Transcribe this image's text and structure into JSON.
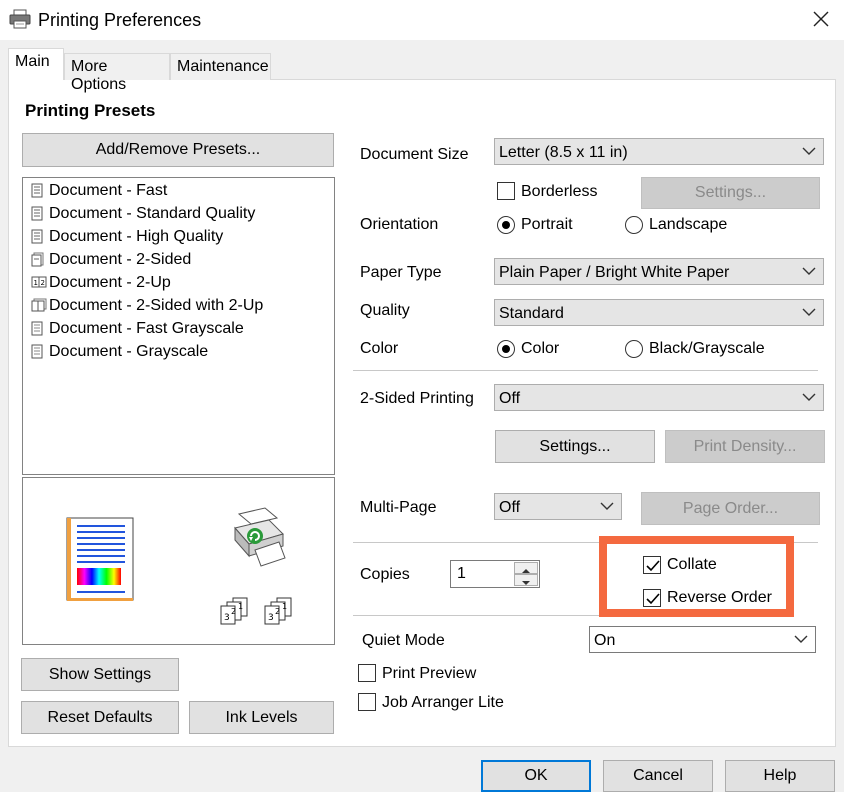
{
  "window": {
    "title": "Printing Preferences"
  },
  "tabs": [
    {
      "label": "Main"
    },
    {
      "label": "More Options"
    },
    {
      "label": "Maintenance"
    }
  ],
  "presets": {
    "heading": "Printing Presets",
    "add_remove_label": "Add/Remove Presets...",
    "items": [
      {
        "label": "Document - Fast"
      },
      {
        "label": "Document - Standard Quality"
      },
      {
        "label": "Document - High Quality"
      },
      {
        "label": "Document - 2-Sided"
      },
      {
        "label": "Document - 2-Up"
      },
      {
        "label": "Document - 2-Sided with 2-Up"
      },
      {
        "label": "Document - Fast Grayscale"
      },
      {
        "label": "Document - Grayscale"
      }
    ]
  },
  "settings": {
    "document_size_label": "Document Size",
    "document_size_value": "Letter (8.5 x 11 in)",
    "borderless_label": "Borderless",
    "borderless_settings_label": "Settings...",
    "orientation_label": "Orientation",
    "portrait_label": "Portrait",
    "landscape_label": "Landscape",
    "paper_type_label": "Paper Type",
    "paper_type_value": "Plain Paper / Bright White Paper",
    "quality_label": "Quality",
    "quality_value": "Standard",
    "color_label": "Color",
    "color_option_label": "Color",
    "bw_option_label": "Black/Grayscale",
    "two_sided_label": "2-Sided Printing",
    "two_sided_value": "Off",
    "two_sided_settings_label": "Settings...",
    "print_density_label": "Print Density...",
    "multi_page_label": "Multi-Page",
    "multi_page_value": "Off",
    "page_order_label": "Page Order...",
    "copies_label": "Copies",
    "copies_value": "1",
    "collate_label": "Collate",
    "reverse_order_label": "Reverse Order",
    "quiet_mode_label": "Quiet Mode",
    "quiet_mode_value": "On",
    "print_preview_label": "Print Preview",
    "job_arranger_label": "Job Arranger Lite"
  },
  "bottom": {
    "show_settings_label": "Show Settings",
    "reset_defaults_label": "Reset Defaults",
    "ink_levels_label": "Ink Levels"
  },
  "dialog_buttons": {
    "ok_label": "OK",
    "cancel_label": "Cancel",
    "help_label": "Help"
  },
  "state": {
    "orientation": "portrait",
    "color_mode": "color",
    "borderless_checked": false,
    "collate_checked": true,
    "reverse_order_checked": true,
    "print_preview_checked": false,
    "job_arranger_checked": false
  },
  "colors": {
    "highlight_border": "#f4693f",
    "default_button_border": "#0078d7"
  }
}
